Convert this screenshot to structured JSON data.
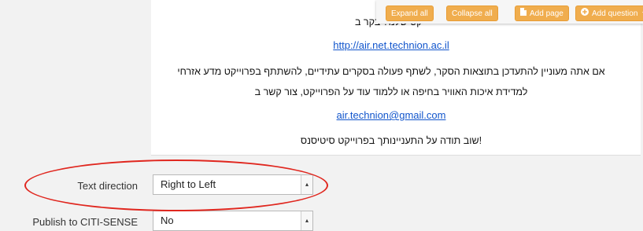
{
  "preview": {
    "line1": "ייקט שלנו? בקר ב",
    "link1": "http://air.net.technion.ac.il",
    "line2": "אם אתה מעוניין להתעדכן בתוצאות הסקר, לשתף פעולה בסקרים עתידיים, להשתתף בפרוייקט מדע אזרחי",
    "line3": "למדידת איכות האוויר בחיפה או ללמוד עוד על הפרוייקט, צור קשר ב",
    "link2": "air.technion@gmail.com",
    "line4": "!שוב תודה על התעניינותך בפרוייקט סיטיסנס"
  },
  "toolbar": {
    "expand_all": "Expand all",
    "collapse_all": "Collapse all",
    "add_page": "Add page",
    "add_question": "Add question",
    "accent_color": "#f0ad4e"
  },
  "form": {
    "text_direction": {
      "label": "Text direction",
      "value": "Right to Left"
    },
    "publish": {
      "label": "Publish to CITI-SENSE",
      "value": "No"
    }
  },
  "annotation": {
    "color": "#e0271f"
  }
}
